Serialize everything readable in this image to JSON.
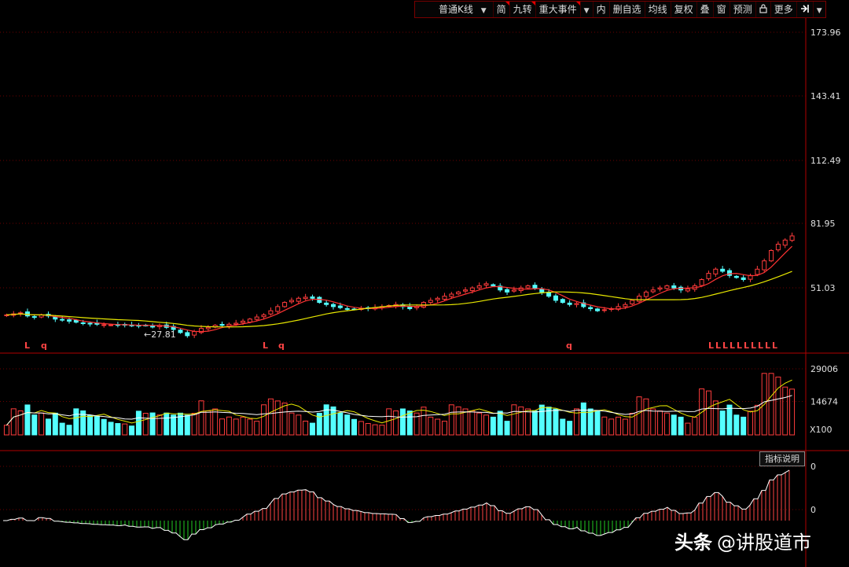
{
  "toolbar": {
    "kline_type": "普通K线",
    "simple": "简",
    "nine_turn": "九转",
    "major_events": "重大事件",
    "inner": "内",
    "delete_watch": "删自选",
    "ma_lines": "均线",
    "restore_rights": "复权",
    "overlay": "叠",
    "window": "窗",
    "forecast": "预测",
    "more": "更多"
  },
  "icons": {
    "dropdown": "chevron-down-icon",
    "lock": "lock-icon",
    "exit": "exit-arrow-icon"
  },
  "price_axis": [
    "173.96",
    "143.41",
    "112.49",
    "81.95",
    "51.03"
  ],
  "volume_axis": [
    "29006",
    "14674",
    "X100"
  ],
  "indicator_axis": [
    "0",
    "0"
  ],
  "low_label": "←27.81",
  "indicator_button": "指标说明",
  "watermark": {
    "brand": "头条",
    "account": "@讲股道市"
  },
  "colors": {
    "up": "#ff3c3c",
    "down": "#54ffff",
    "ma_short": "#ff3333",
    "ma_long": "#e8e800",
    "vol_ma_short": "#ffffff",
    "vol_ma_long": "#e8e800",
    "indicator_up": "#ff4444",
    "indicator_down": "#22cc22",
    "grid": "#6b0000",
    "axis_text": "#e0e0e0",
    "signal_text": "#ff4444"
  },
  "chart_data": {
    "type": "candlestick",
    "price_axis_ticks": [
      173.96,
      143.41,
      112.49,
      81.95,
      51.03
    ],
    "volume_axis_ticks": [
      29006,
      14674
    ],
    "volume_unit": "X100",
    "low_marker": 27.81,
    "signals": [
      "L",
      "q",
      "L",
      "q",
      "q",
      "L",
      "L",
      "L",
      "L",
      "L",
      "L",
      "L",
      "L",
      "L",
      "L"
    ],
    "close_trend": [
      38,
      38.5,
      39,
      37.5,
      37,
      38,
      37.5,
      36,
      35.5,
      35,
      34.5,
      34,
      33.8,
      33.5,
      33.3,
      33.2,
      33,
      33.4,
      33,
      32.8,
      33,
      32.5,
      33,
      32,
      31,
      29.5,
      28,
      30,
      31.5,
      32,
      33,
      33,
      33.5,
      34,
      35,
      36,
      37,
      38,
      40,
      42,
      44,
      45,
      46,
      46.5,
      46,
      44,
      43,
      42,
      41.5,
      41,
      40.8,
      41,
      41.2,
      41.5,
      42,
      42.5,
      43,
      42,
      41,
      42,
      44,
      45,
      46,
      47,
      48,
      49,
      50,
      51,
      52,
      53,
      52,
      50,
      49,
      50,
      51,
      52,
      51,
      49,
      47,
      45,
      44,
      43,
      43.5,
      42,
      41,
      40,
      40.5,
      41,
      42,
      43,
      45,
      47,
      49,
      50,
      51,
      52,
      51,
      50,
      50.5,
      52,
      55,
      58,
      60,
      59,
      57,
      56,
      55,
      57,
      60,
      64,
      69,
      72,
      74,
      76
    ]
  }
}
